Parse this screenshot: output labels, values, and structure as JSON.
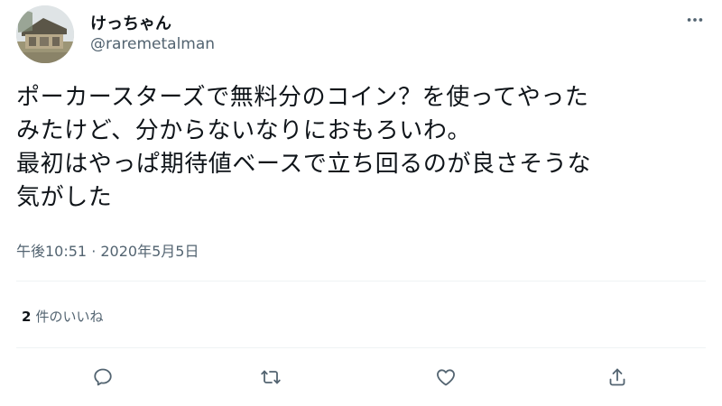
{
  "user": {
    "display_name": "けっちゃん",
    "handle": "@raremetalman",
    "avatar_icon": "house-photo-avatar"
  },
  "tweet": {
    "lines": [
      "ポーカースターズで無料分のコイン？を使ってやった",
      "みたけど、分からないなりにおもろいわ。",
      "最初はやっぱ期待値ベースで立ち回るのが良さそうな",
      "気がした"
    ],
    "timestamp": "午後10:51 · 2020年5月5日"
  },
  "stats": {
    "likes_count": "2",
    "likes_label": "件のいいね"
  },
  "actions": {
    "icons": [
      "reply-icon",
      "retweet-icon",
      "like-icon",
      "share-icon"
    ]
  },
  "colors": {
    "text": "#0f1419",
    "secondary": "#536471",
    "divider": "#eff3f4"
  }
}
